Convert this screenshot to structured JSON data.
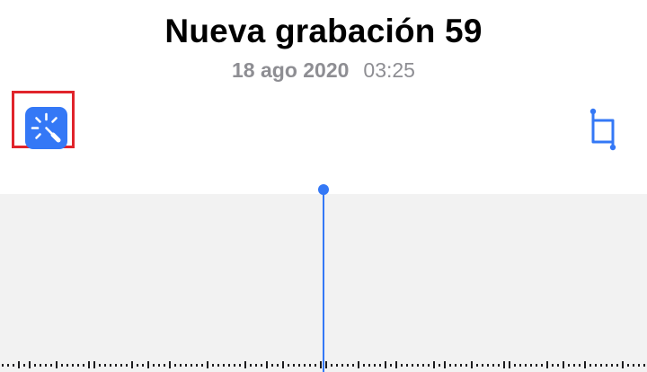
{
  "recording": {
    "title": "Nueva grabación 59",
    "date": "18 ago 2020",
    "duration": "03:25"
  },
  "toolbar": {
    "enhance_icon": "magic-wand-icon",
    "crop_icon": "crop-icon"
  },
  "colors": {
    "accent": "#3478f6",
    "highlight_border": "#e0242b",
    "secondary_text": "#8e8e93",
    "waveform_bg": "#f2f2f2"
  }
}
